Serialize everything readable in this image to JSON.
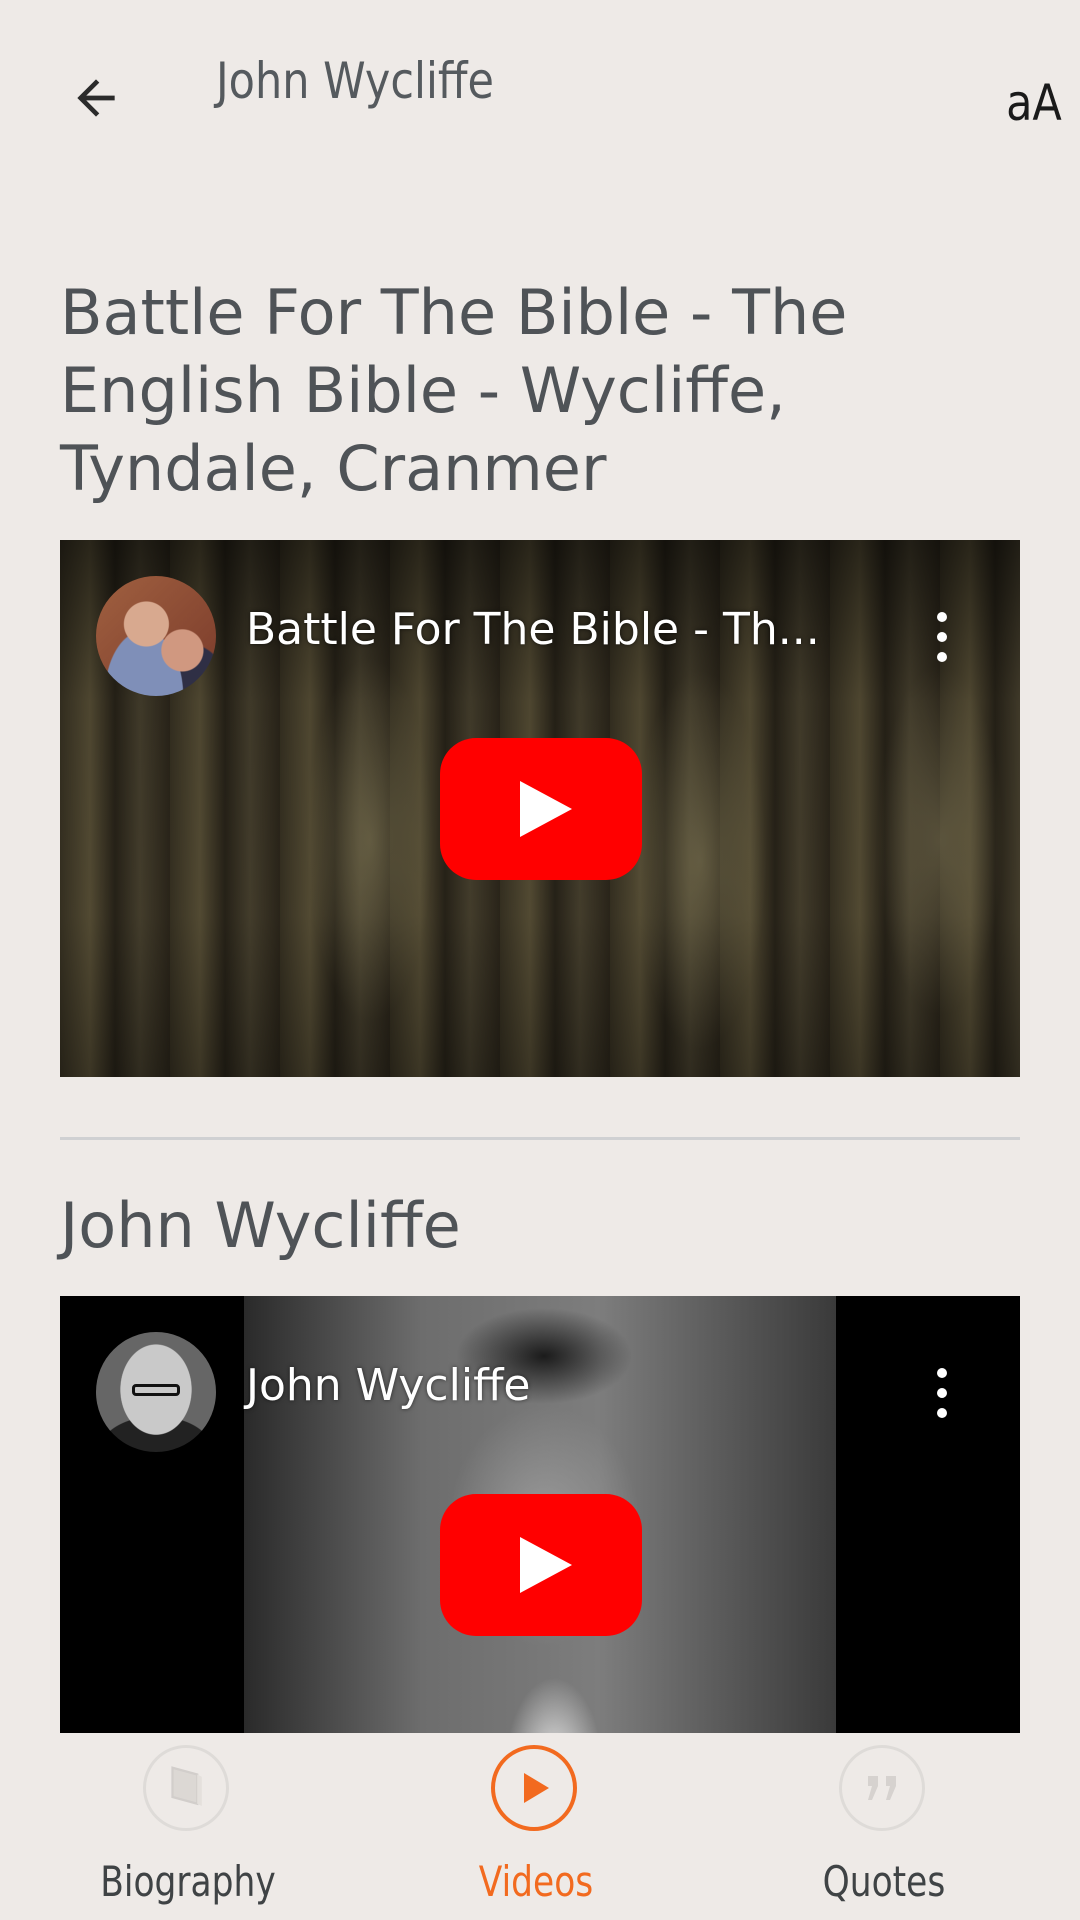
{
  "header": {
    "title": "John Wycliffe",
    "text_size_label": "aA",
    "back_icon": "arrow-left-icon"
  },
  "videos": [
    {
      "heading": "Battle For The Bible - The English Bible - Wycliffe, Tyndale, Cranmer",
      "overlay_title": "Battle For The Bible - Th...",
      "channel_avatar": "channel-avatar-couple",
      "play_icon": "youtube-play-icon",
      "menu_icon": "more-vertical-icon"
    },
    {
      "heading": "John Wycliffe",
      "overlay_title": "John Wycliffe",
      "channel_avatar": "channel-avatar-man-glasses",
      "play_icon": "youtube-play-icon",
      "menu_icon": "more-vertical-icon"
    }
  ],
  "bottom_nav": {
    "items": [
      {
        "label": "Biography",
        "icon": "book-icon",
        "active": false
      },
      {
        "label": "Videos",
        "icon": "play-icon",
        "active": true
      },
      {
        "label": "Quotes",
        "icon": "quote-icon",
        "active": false
      }
    ]
  },
  "colors": {
    "background": "#eeeae7",
    "accent": "#f26a1f",
    "youtube_red": "#ff0000",
    "heading_text": "#4f5357"
  }
}
